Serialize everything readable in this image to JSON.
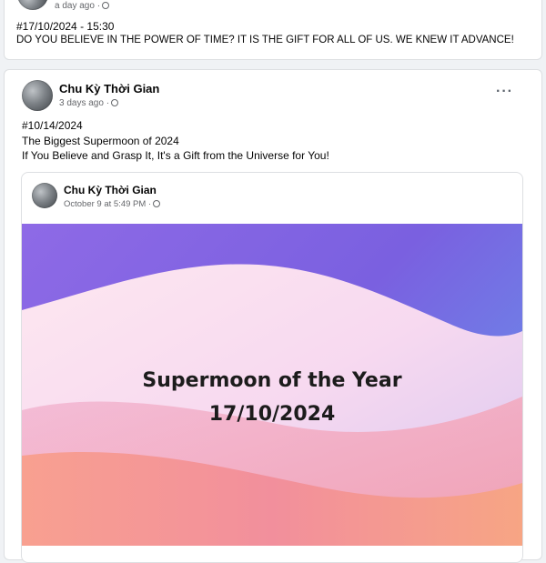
{
  "top_post": {
    "timestamp": "a day ago ·",
    "line1": "#17/10/2024 - 15:30",
    "line2": "DO YOU BELIEVE IN THE POWER OF TIME? IT IS THE GIFT FOR ALL OF US. WE KNEW IT ADVANCE!"
  },
  "shared_post": {
    "author": "Chu Kỳ Thời Gian",
    "timestamp": "3 days ago ·",
    "more_label": "···",
    "lines": [
      "#10/14/2024",
      "The Biggest Supermoon of 2024",
      "If You Believe and Grasp It, It's a Gift from the Universe for You!"
    ],
    "embedded": {
      "author": "Chu Kỳ Thời Gian",
      "timestamp": "October 9 at 5:49 PM ·",
      "image_title_line1": "Supermoon of the Year",
      "image_title_line2": "17/10/2024"
    }
  },
  "icons": {
    "privacy": "globe-icon",
    "menu": "more-options-icon"
  },
  "colors": {
    "page_bg": "#f0f2f5",
    "card_bg": "#ffffff",
    "meta_text": "#65676b"
  }
}
